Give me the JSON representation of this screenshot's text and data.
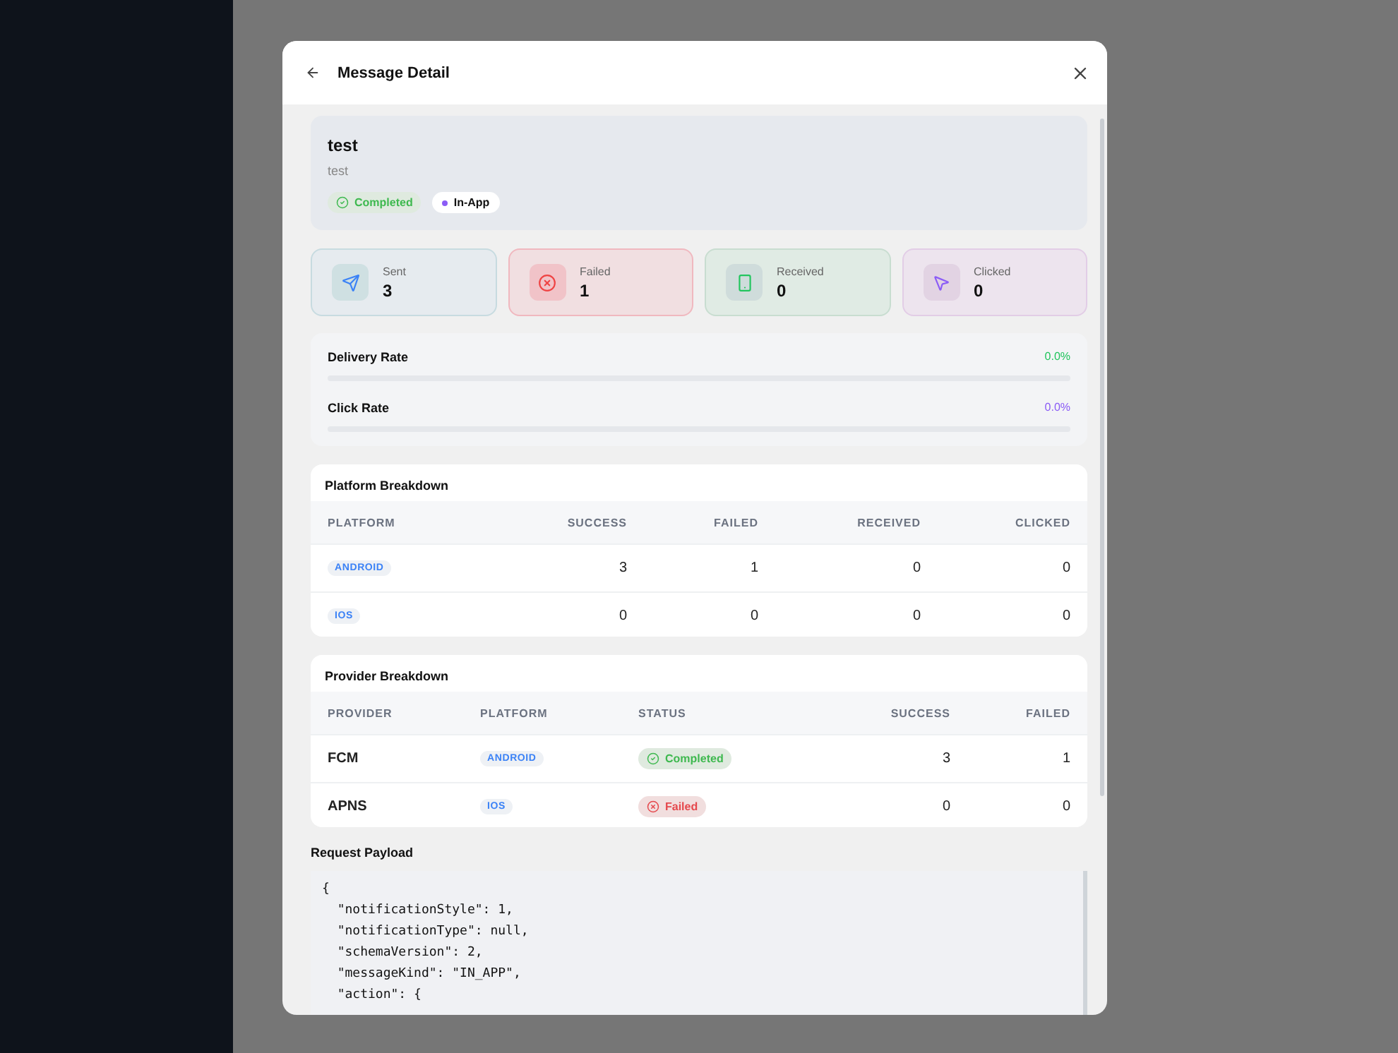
{
  "modal": {
    "title": "Message Detail"
  },
  "message": {
    "title": "test",
    "subtitle": "test",
    "status": {
      "label": "Completed",
      "kind": "completed"
    },
    "channel": {
      "label": "In-App"
    }
  },
  "stats": [
    {
      "kind": "sent",
      "label": "Sent",
      "value": "3"
    },
    {
      "kind": "failed",
      "label": "Failed",
      "value": "1"
    },
    {
      "kind": "received",
      "label": "Received",
      "value": "0"
    },
    {
      "kind": "clicked",
      "label": "Clicked",
      "value": "0"
    }
  ],
  "rates": [
    {
      "label": "Delivery Rate",
      "reading": "0.0%",
      "level": 0,
      "color": "#22c55e"
    },
    {
      "label": "Click Rate",
      "reading": "0.0%",
      "level": 0,
      "color": "#8b5cf6"
    }
  ],
  "platform_breakdown": {
    "title": "Platform Breakdown",
    "columns": [
      "PLATFORM",
      "SUCCESS",
      "FAILED",
      "RECEIVED",
      "CLICKED"
    ],
    "rows": [
      {
        "platform": "ANDROID",
        "success": "3",
        "failed": "1",
        "received": "0",
        "clicked": "0"
      },
      {
        "platform": "IOS",
        "success": "0",
        "failed": "0",
        "received": "0",
        "clicked": "0"
      }
    ]
  },
  "provider_breakdown": {
    "title": "Provider Breakdown",
    "columns": [
      "PROVIDER",
      "PLATFORM",
      "STATUS",
      "SUCCESS",
      "FAILED"
    ],
    "rows": [
      {
        "provider": "FCM",
        "platform": "ANDROID",
        "status": {
          "label": "Completed",
          "kind": "completed"
        },
        "success": "3",
        "failed": "1"
      },
      {
        "provider": "APNS",
        "platform": "IOS",
        "status": {
          "label": "Failed",
          "kind": "failed"
        },
        "success": "0",
        "failed": "0"
      }
    ]
  },
  "payload": {
    "title": "Request Payload",
    "lines": [
      "{",
      "  \"notificationStyle\": 1,",
      "  \"notificationType\": null,",
      "  \"schemaVersion\": 2,",
      "  \"messageKind\": \"IN_APP\",",
      "  \"action\": {"
    ]
  }
}
